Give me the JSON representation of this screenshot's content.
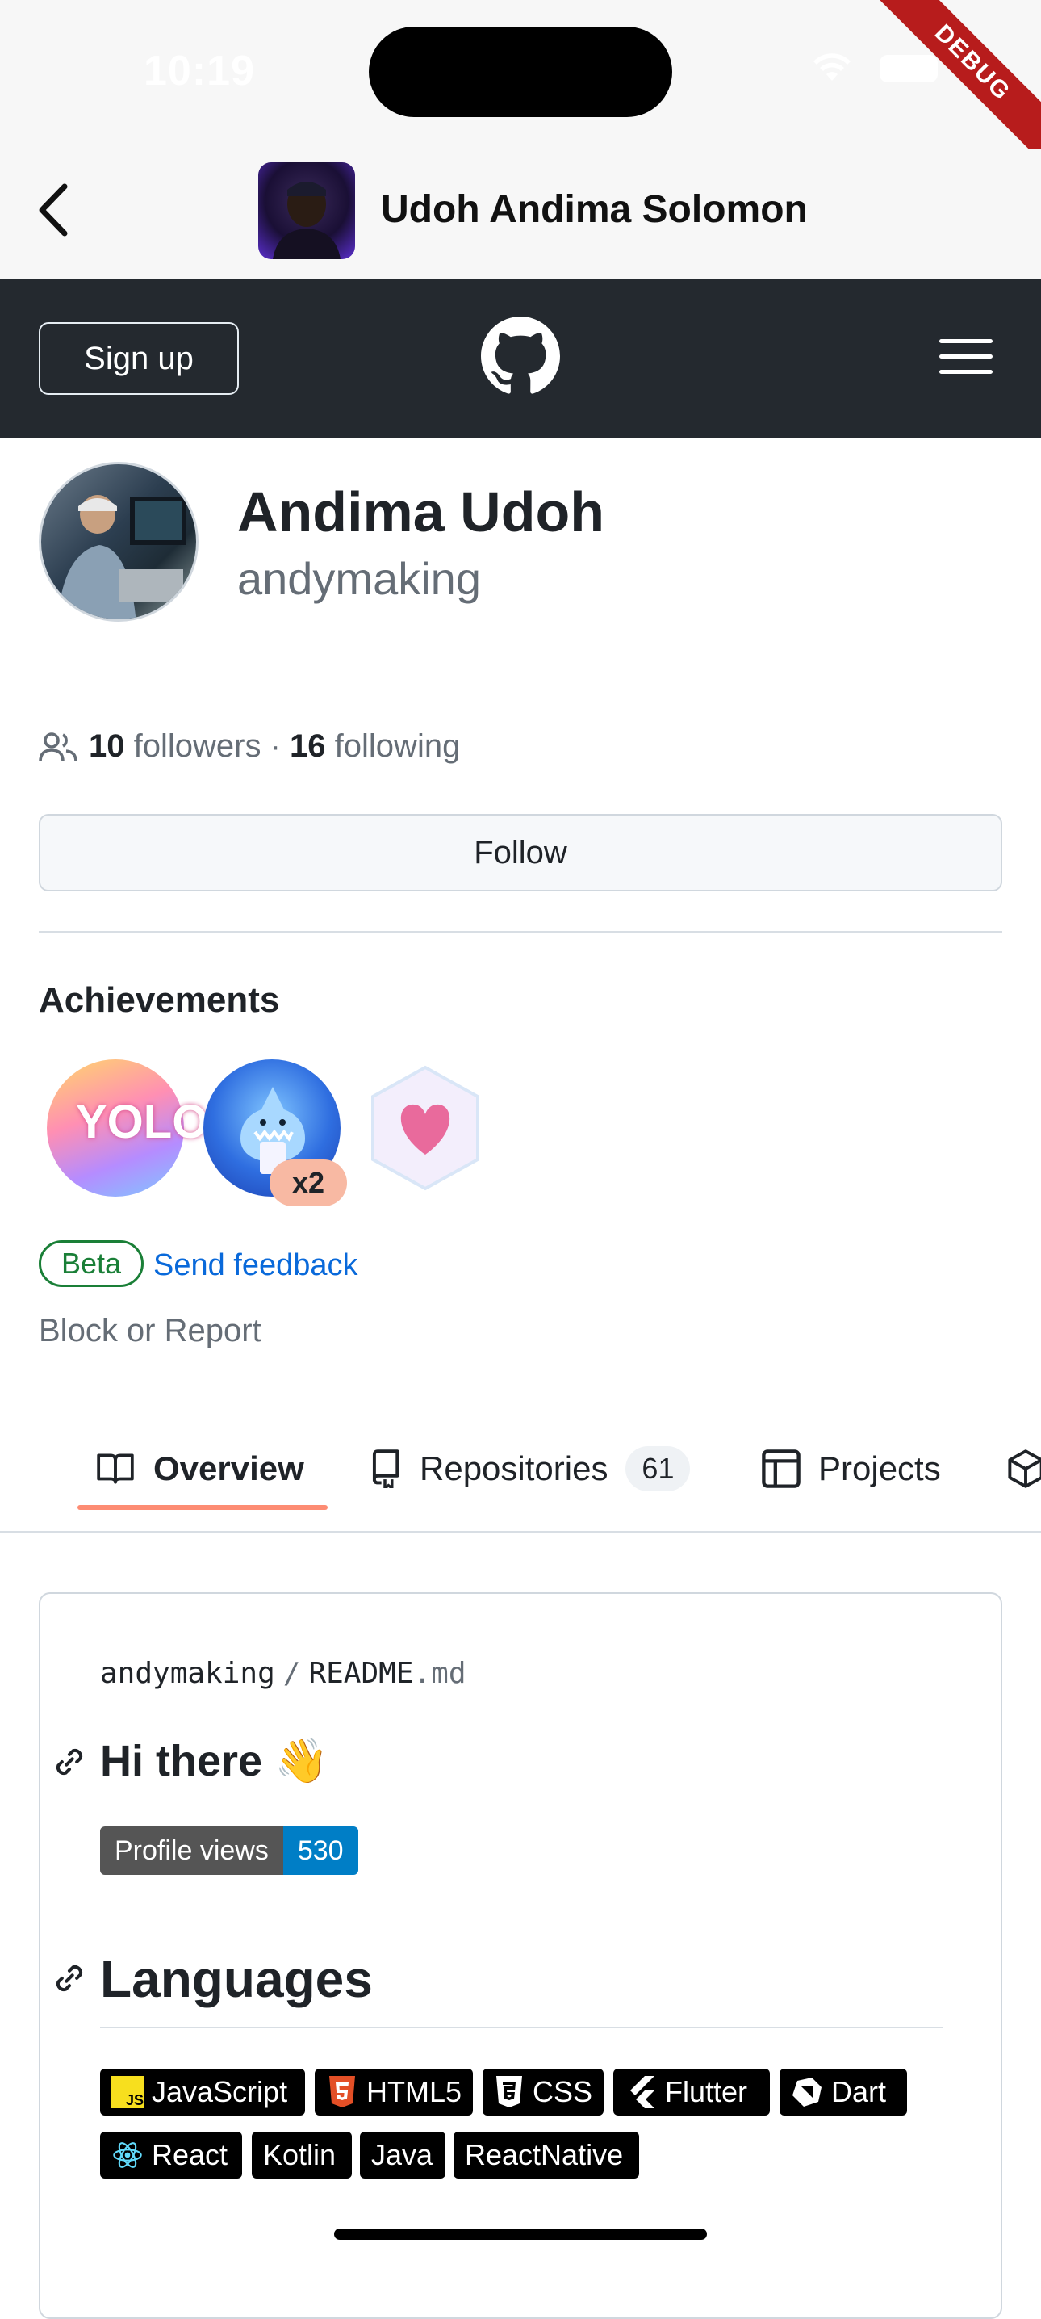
{
  "status_bar": {
    "time": "10:19",
    "debug_label": "DEBUG"
  },
  "app_bar": {
    "title": "Udoh Andima Solomon"
  },
  "github_header": {
    "signup_label": "Sign up"
  },
  "profile": {
    "name": "Andima Udoh",
    "login": "andymaking",
    "followers_count": "10",
    "followers_label": "followers",
    "separator": "·",
    "following_count": "16",
    "following_label": "following",
    "follow_button": "Follow"
  },
  "achievements": {
    "title": "Achievements",
    "badge_multiplier": "x2",
    "beta_label": "Beta",
    "feedback_link": "Send feedback",
    "block_report": "Block or Report"
  },
  "tabs": {
    "overview": "Overview",
    "repositories": "Repositories",
    "repositories_count": "61",
    "projects": "Projects"
  },
  "readme": {
    "owner": "andymaking",
    "path_sep": "/",
    "file_name": "README",
    "file_ext": ".md",
    "heading_hi": "Hi there 👋",
    "profile_views_label": "Profile views",
    "profile_views_value": "530",
    "languages_heading": "Languages",
    "languages": [
      "JavaScript",
      "HTML5",
      "CSS",
      "Flutter",
      "Dart",
      "React",
      "Kotlin",
      "Java",
      "ReactNative"
    ]
  },
  "colors": {
    "github_dark": "#24292f",
    "tab_underline": "#fd8c73",
    "beta_green": "#1a7f37",
    "link_blue": "#0969da",
    "profile_views_blue": "#007ec6",
    "debug_red": "#b71c1c"
  }
}
